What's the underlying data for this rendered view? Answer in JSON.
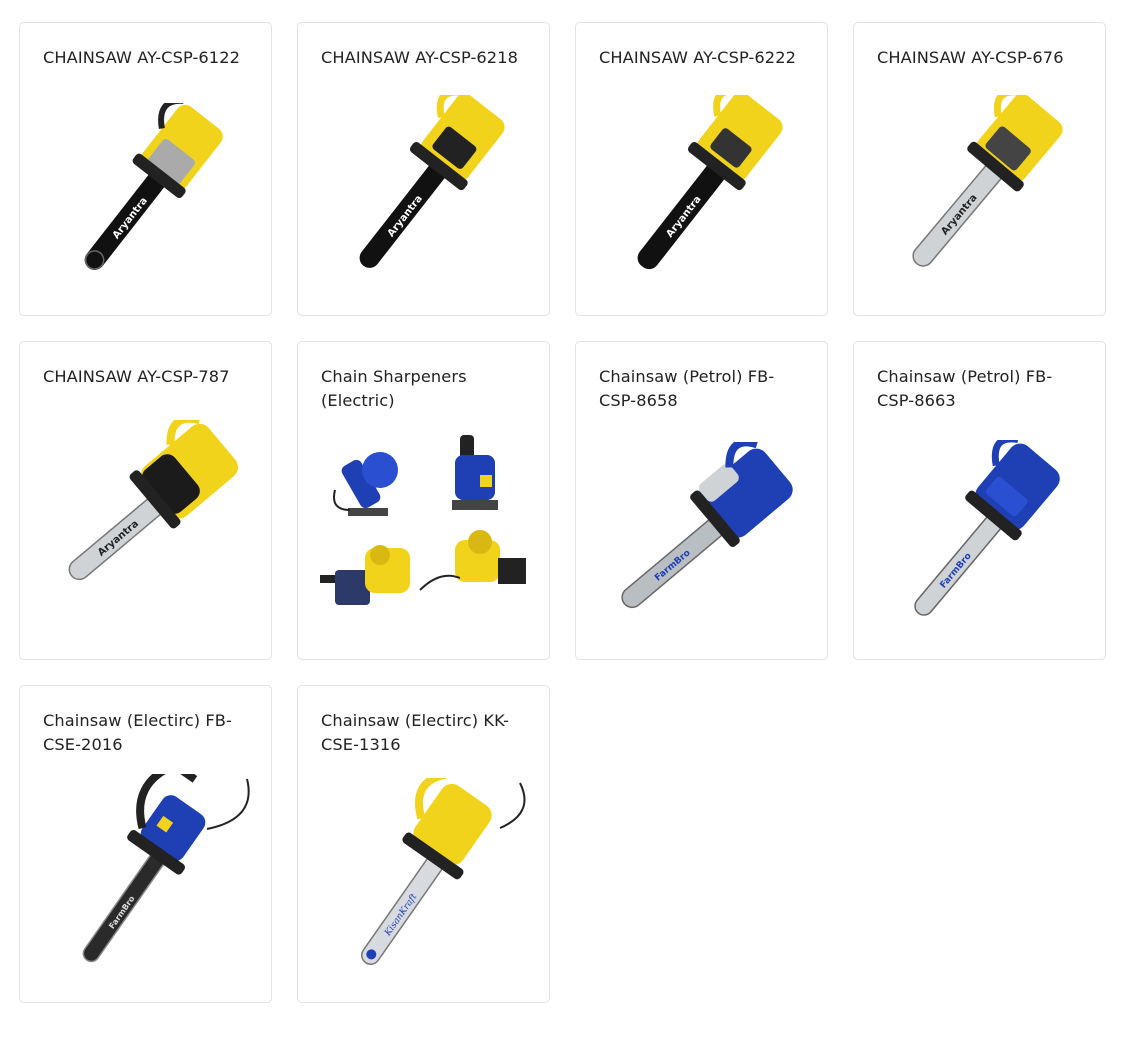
{
  "products": [
    {
      "title": "CHAINSAW AY-CSP-6122",
      "image": "chainsaw-yellow-black-bar-icon",
      "bar_text": "Aryantra"
    },
    {
      "title": "CHAINSAW AY-CSP-6218",
      "image": "chainsaw-yellow-black-bar-icon",
      "bar_text": "Aryantra"
    },
    {
      "title": "CHAINSAW AY-CSP-6222",
      "image": "chainsaw-yellow-black-bar-icon",
      "bar_text": "Aryantra"
    },
    {
      "title": "CHAINSAW AY-CSP-676",
      "image": "chainsaw-yellow-silver-bar-icon",
      "bar_text": "Aryantra"
    },
    {
      "title": "CHAINSAW AY-CSP-787",
      "image": "chainsaw-yellow-silver-bar-icon",
      "bar_text": "Aryantra"
    },
    {
      "title": "Chain Sharpeners (Electric)",
      "image": "chain-sharpeners-icon"
    },
    {
      "title": "Chainsaw (Petrol) FB-CSP-8658",
      "image": "chainsaw-blue-icon",
      "bar_text": "FarmBro"
    },
    {
      "title": "Chainsaw (Petrol) FB-CSP-8663",
      "image": "chainsaw-blue-icon",
      "bar_text": "FarmBro"
    },
    {
      "title": "Chainsaw (Electirc) FB-CSE-2016",
      "image": "electric-chainsaw-blue-icon",
      "bar_text": "FarmBro"
    },
    {
      "title": "Chainsaw (Electirc) KK-CSE-1316",
      "image": "electric-chainsaw-yellow-icon",
      "bar_text": "KisanKraft"
    }
  ],
  "colors": {
    "yellow": "#f2d31b",
    "blue": "#1f3fb5",
    "card_border": "#e3e3e3"
  }
}
